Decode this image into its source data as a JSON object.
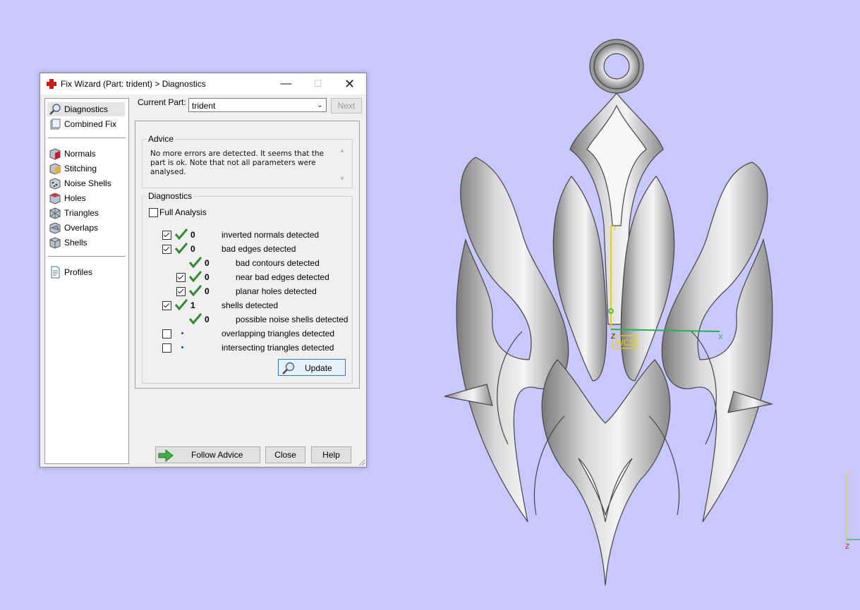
{
  "window": {
    "title": "Fix Wizard (Part: trident) > Diagnostics",
    "controls": {
      "minimize": "—",
      "maximize": "☐",
      "close": "✕"
    }
  },
  "sidebar": {
    "items": [
      {
        "label": "Diagnostics",
        "icon": "magnifier-icon",
        "selected": true
      },
      {
        "label": "Combined Fix",
        "icon": "combined-fix-icon"
      },
      {
        "label": "Normals",
        "icon": "normals-cube-icon"
      },
      {
        "label": "Stitching",
        "icon": "stitching-cube-icon"
      },
      {
        "label": "Noise Shells",
        "icon": "noise-shells-icon"
      },
      {
        "label": "Holes",
        "icon": "holes-cube-icon"
      },
      {
        "label": "Triangles",
        "icon": "triangles-cube-icon"
      },
      {
        "label": "Overlaps",
        "icon": "overlaps-cube-icon"
      },
      {
        "label": "Shells",
        "icon": "shells-cube-icon"
      },
      {
        "label": "Profiles",
        "icon": "profiles-document-icon"
      }
    ]
  },
  "current_part": {
    "label": "Current Part:",
    "value": "trident"
  },
  "next_button": {
    "label": "Next",
    "enabled": false
  },
  "advice": {
    "legend": "Advice",
    "text": "No more errors are detected. It seems that the part is ok. Note that not all parameters were analysed."
  },
  "diagnostics": {
    "legend": "Diagnostics",
    "full_analysis": {
      "label": "Full Analysis",
      "checked": false
    },
    "rows": [
      {
        "checkbox": true,
        "checked": true,
        "status": "ok",
        "count": "0",
        "label": "inverted normals detected",
        "indent": 0
      },
      {
        "checkbox": true,
        "checked": true,
        "status": "ok",
        "count": "0",
        "label": "bad edges detected",
        "indent": 0
      },
      {
        "checkbox": false,
        "checked": false,
        "status": "ok",
        "count": "0",
        "label": "bad contours detected",
        "indent": 1
      },
      {
        "checkbox": true,
        "checked": true,
        "status": "ok",
        "count": "0",
        "label": "near bad edges detected",
        "indent": 1
      },
      {
        "checkbox": true,
        "checked": true,
        "status": "ok",
        "count": "0",
        "label": "planar holes detected",
        "indent": 1
      },
      {
        "checkbox": true,
        "checked": true,
        "status": "ok",
        "count": "1",
        "label": "shells detected",
        "indent": 0
      },
      {
        "checkbox": false,
        "checked": false,
        "status": "ok",
        "count": "0",
        "label": "possible noise shells detected",
        "indent": 1
      },
      {
        "checkbox": true,
        "checked": false,
        "status": "pending",
        "count": "",
        "label": "overlapping triangles detected",
        "indent": 0
      },
      {
        "checkbox": true,
        "checked": false,
        "status": "pending",
        "count": "",
        "label": "intersecting triangles detected",
        "indent": 0
      }
    ],
    "update_button": {
      "label": "Update"
    }
  },
  "footer": {
    "follow_advice": "Follow Advice",
    "close": "Close",
    "help": "Help"
  },
  "viewport": {
    "wcs_label": "WCS",
    "axis_x": "X",
    "axis_y": "Y",
    "axis_z": "Z",
    "mini_axis_z": "Z",
    "background": "#c8c8fc"
  },
  "colors": {
    "check_green": "#2e8b2e",
    "accent_blue": "#2b78c4",
    "axis_green": "#22b34a",
    "axis_yellow": "#e8d400",
    "axis_red": "#d11a1a"
  }
}
